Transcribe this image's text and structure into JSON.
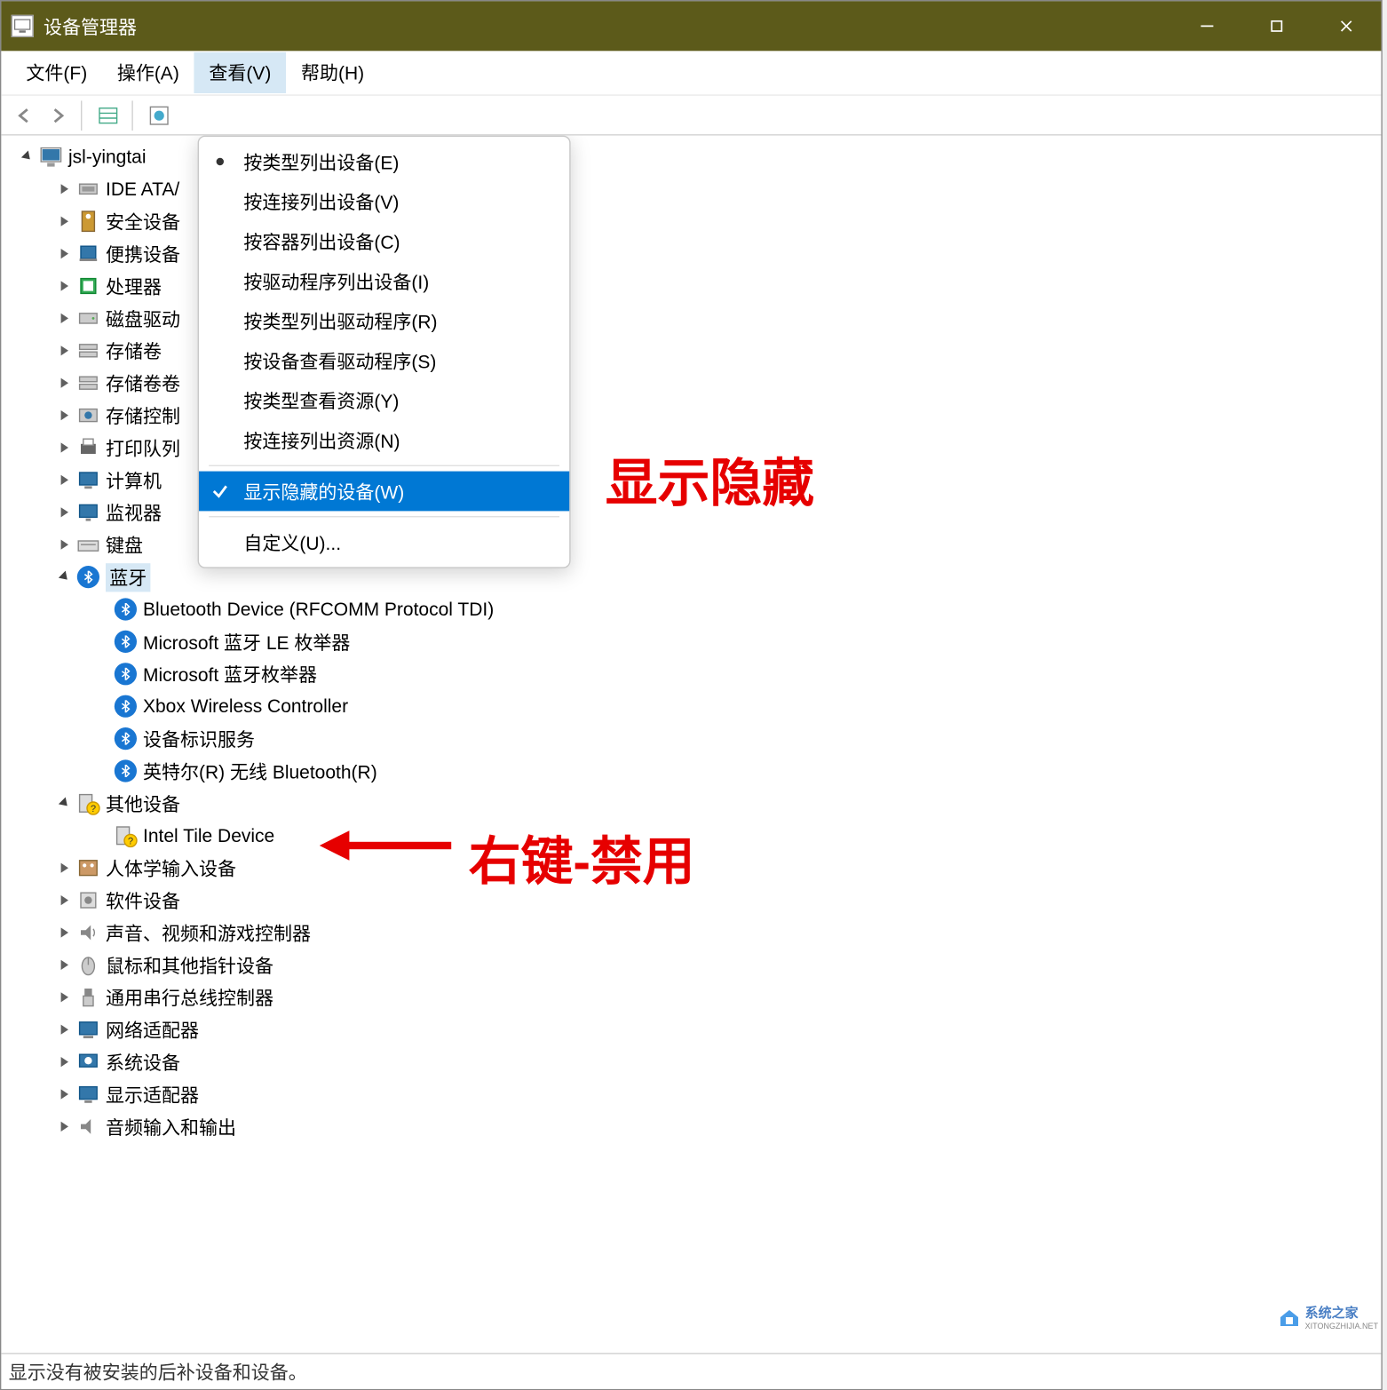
{
  "window": {
    "title": "设备管理器"
  },
  "menubar": {
    "file": "文件(F)",
    "action": "操作(A)",
    "view": "查看(V)",
    "help": "帮助(H)"
  },
  "dropdown": {
    "items": [
      "按类型列出设备(E)",
      "按连接列出设备(V)",
      "按容器列出设备(C)",
      "按驱动程序列出设备(I)",
      "按类型列出驱动程序(R)",
      "按设备查看驱动程序(S)",
      "按类型查看资源(Y)",
      "按连接列出资源(N)"
    ],
    "highlighted": "显示隐藏的设备(W)",
    "customize": "自定义(U)..."
  },
  "tree": {
    "root": "jsl-yingtai",
    "nodes": [
      {
        "label": "IDE ATA/",
        "icon": "ide"
      },
      {
        "label": "安全设备",
        "icon": "security"
      },
      {
        "label": "便携设备",
        "icon": "portable"
      },
      {
        "label": "处理器",
        "icon": "cpu"
      },
      {
        "label": "磁盘驱动",
        "icon": "disk"
      },
      {
        "label": "存储卷",
        "icon": "storage"
      },
      {
        "label": "存储卷卷",
        "icon": "storage"
      },
      {
        "label": "存储控制",
        "icon": "storagectrl"
      },
      {
        "label": "打印队列",
        "icon": "printer"
      },
      {
        "label": "计算机",
        "icon": "computer"
      },
      {
        "label": "监视器",
        "icon": "monitor"
      },
      {
        "label": "键盘",
        "icon": "keyboard"
      }
    ],
    "bluetooth": {
      "label": "蓝牙",
      "children": [
        "Bluetooth Device (RFCOMM Protocol TDI)",
        "Microsoft 蓝牙 LE 枚举器",
        "Microsoft 蓝牙枚举器",
        "Xbox Wireless Controller",
        "设备标识服务",
        "英特尔(R) 无线 Bluetooth(R)"
      ]
    },
    "other": {
      "label": "其他设备",
      "children": [
        "Intel Tile Device"
      ]
    },
    "rest": [
      {
        "label": "人体学输入设备",
        "icon": "hid"
      },
      {
        "label": "软件设备",
        "icon": "software"
      },
      {
        "label": "声音、视频和游戏控制器",
        "icon": "audio"
      },
      {
        "label": "鼠标和其他指针设备",
        "icon": "mouse"
      },
      {
        "label": "通用串行总线控制器",
        "icon": "usb"
      },
      {
        "label": "网络适配器",
        "icon": "network"
      },
      {
        "label": "系统设备",
        "icon": "system"
      },
      {
        "label": "显示适配器",
        "icon": "display"
      },
      {
        "label": "音频输入和输出",
        "icon": "audioinout"
      }
    ]
  },
  "annotations": {
    "text1": "显示隐藏",
    "text2": "右键-禁用"
  },
  "statusbar": "显示没有被安装的后补设备和设备。",
  "watermark": {
    "name": "系统之家",
    "url": "XITONGZHIJIA.NET"
  }
}
